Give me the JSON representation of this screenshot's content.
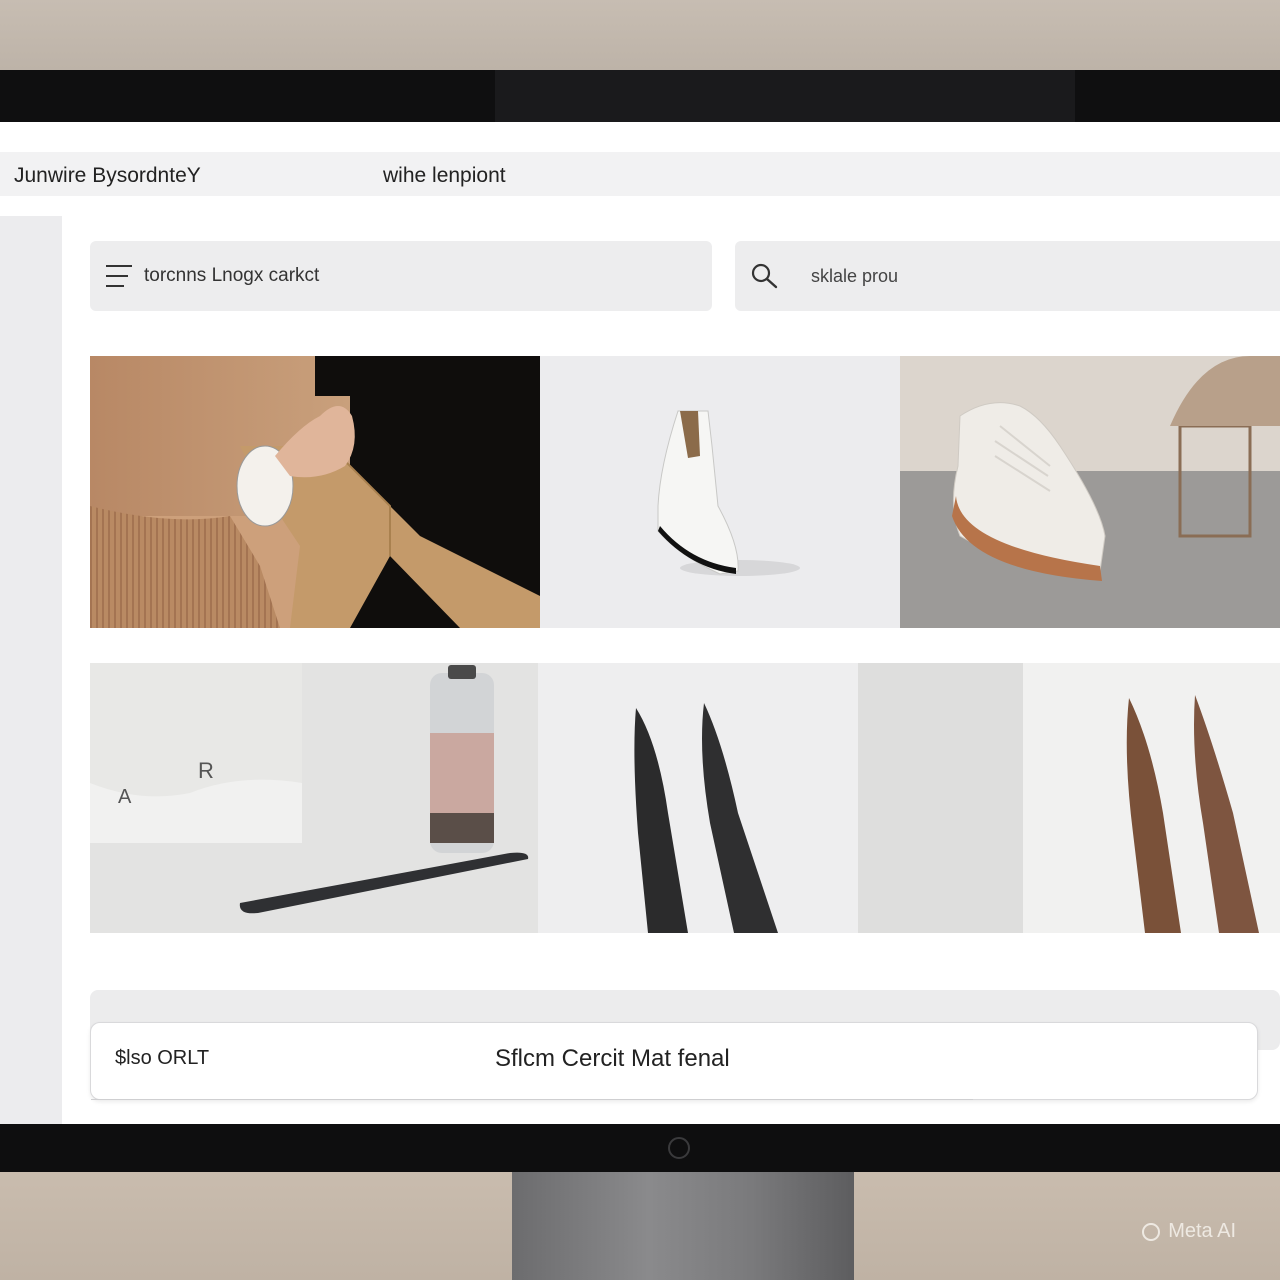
{
  "window": {
    "title_left": "Junwire BysordnteY",
    "title_right": "wihe lenpiont"
  },
  "toolbar": {
    "menu_label": "torcnns Lnogx carkct",
    "search_placeholder": "sklale prou"
  },
  "products_row1": [
    {
      "icon": "fabric-sample-image"
    },
    {
      "icon": "white-shoe-image"
    },
    {
      "icon": "sneaker-image"
    }
  ],
  "products_row2": [
    {
      "icon": "bottle-and-mat-image"
    },
    {
      "icon": "black-stakes-image"
    },
    {
      "icon": "brown-stakes-image"
    }
  ],
  "bottom_panel": {
    "price_label": "$lso ORLT",
    "material_label": "Sflcm Cercit Mat fenal"
  },
  "watermark": "Meta AI",
  "colors": {
    "bezel": "#0f0f10",
    "toolbar_bg": "#ededee",
    "sidebar_bg": "#ececee"
  }
}
